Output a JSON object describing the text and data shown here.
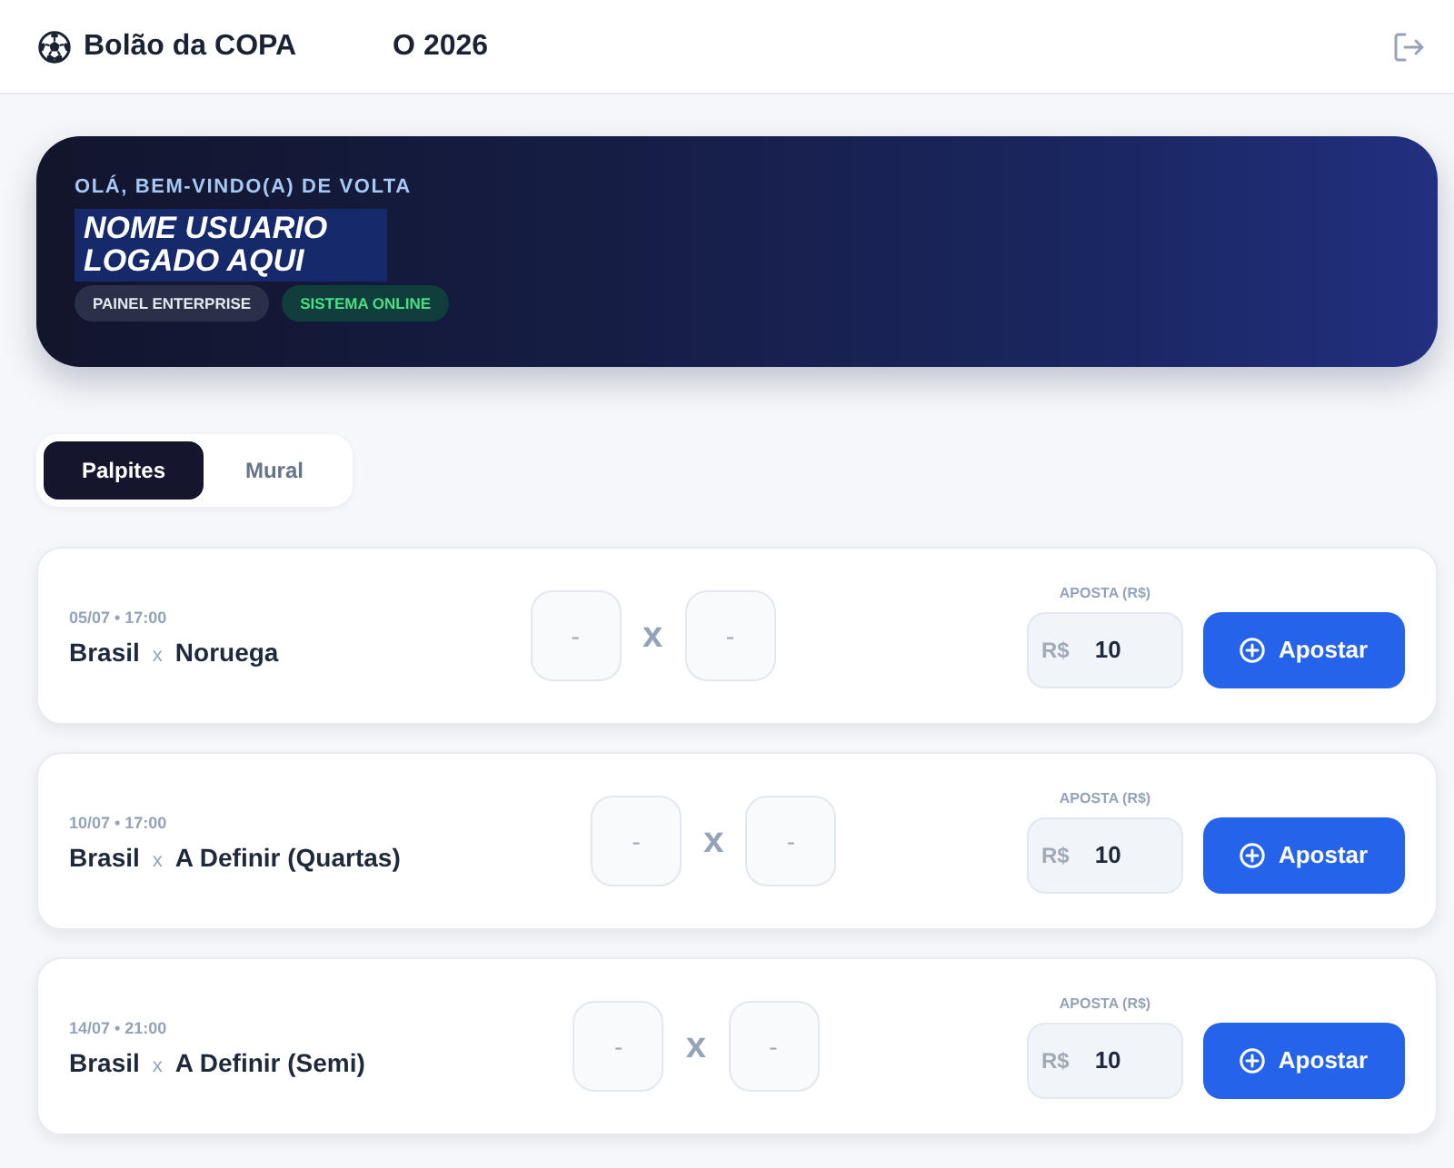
{
  "header": {
    "title": "Bolão da COPA",
    "subtitle": "O 2026"
  },
  "hero": {
    "greeting": "OLÁ, BEM-VINDO(A) DE VOLTA",
    "user_name": "NOME USUARIO LOGADO AQUI",
    "badges": [
      {
        "label": "PAINEL ENTERPRISE",
        "kind": "plan"
      },
      {
        "label": "SISTEMA ONLINE",
        "kind": "status"
      }
    ]
  },
  "tabs": [
    {
      "label": "Palpites",
      "selected": true
    },
    {
      "label": "Mural",
      "selected": false
    }
  ],
  "matches": [
    {
      "datetime": "05/07 • 17:00",
      "home": "Brasil",
      "separator": "x",
      "away": "Noruega",
      "home_score": {
        "placeholder": "-"
      },
      "score_separator": "x",
      "away_score": {
        "placeholder": "-"
      },
      "bet_label": "APOSTA (R$)",
      "currency": "R$",
      "amount": "10",
      "button": "Apostar"
    },
    {
      "datetime": "10/07 • 17:00",
      "home": "Brasil",
      "separator": "x",
      "away": "A Definir (Quartas)",
      "home_score": {
        "placeholder": "-"
      },
      "score_separator": "x",
      "away_score": {
        "placeholder": "-"
      },
      "bet_label": "APOSTA (R$)",
      "currency": "R$",
      "amount": "10",
      "button": "Apostar"
    },
    {
      "datetime": "14/07 • 21:00",
      "home": "Brasil",
      "separator": "x",
      "away": "A Definir (Semi)",
      "home_score": {
        "placeholder": "-"
      },
      "score_separator": "x",
      "away_score": {
        "placeholder": "-"
      },
      "bet_label": "APOSTA (R$)",
      "currency": "R$",
      "amount": "10",
      "button": "Apostar"
    }
  ]
}
